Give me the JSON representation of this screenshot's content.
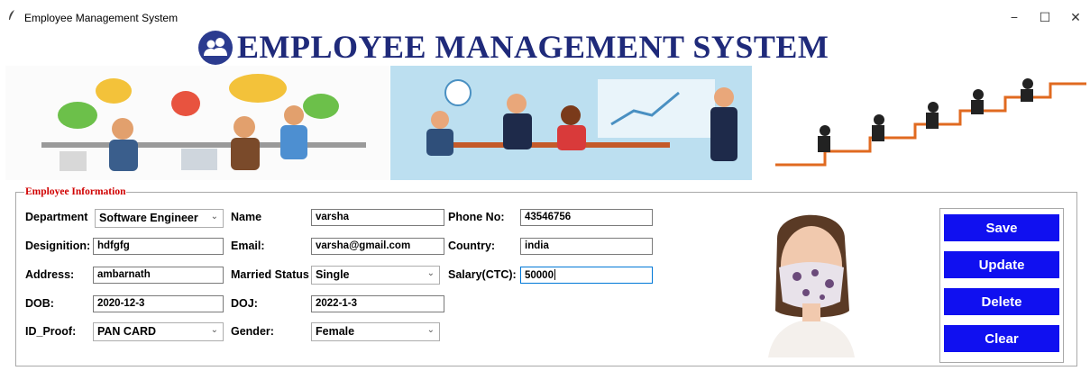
{
  "window": {
    "title": "Employee Management System",
    "controls": {
      "minimize": "−",
      "maximize": "☐",
      "close": "✕"
    }
  },
  "header": {
    "title": "EMPLOYEE MANAGEMENT SYSTEM",
    "logo_icon": "users-icon",
    "color": "#1f2a7a"
  },
  "banner": {
    "panels": [
      "office-team-illustration",
      "meeting-presentation-illustration",
      "teamwork-stairs-illustration"
    ]
  },
  "employee_info": {
    "legend": "Employee Information",
    "department": {
      "label": "Department",
      "value": "Software Engineer"
    },
    "name": {
      "label": "Name",
      "value": "varsha"
    },
    "phone": {
      "label": "Phone No:",
      "value": "43546756"
    },
    "designation": {
      "label": "Designition:",
      "value": "hdfgfg"
    },
    "email": {
      "label": "Email:",
      "value": "varsha@gmail.com"
    },
    "country": {
      "label": "Country:",
      "value": "india"
    },
    "address": {
      "label": "Address:",
      "value": "ambarnath"
    },
    "married_status": {
      "label": "Married Status",
      "value": "Single"
    },
    "salary": {
      "label": "Salary(CTC):",
      "value": "50000"
    },
    "dob": {
      "label": "DOB:",
      "value": "2020-12-3"
    },
    "doj": {
      "label": "DOJ:",
      "value": "2022-1-3"
    },
    "id_proof": {
      "label": "ID_Proof:",
      "value": "PAN CARD"
    },
    "gender": {
      "label": "Gender:",
      "value": "Female"
    }
  },
  "photo": {
    "icon": "employee-photo"
  },
  "buttons": {
    "save": "Save",
    "update": "Update",
    "delete": "Delete",
    "clear": "Clear"
  },
  "colors": {
    "button_bg": "#1010f0",
    "legend": "#d00000",
    "banner_center": "#bcdff0"
  }
}
